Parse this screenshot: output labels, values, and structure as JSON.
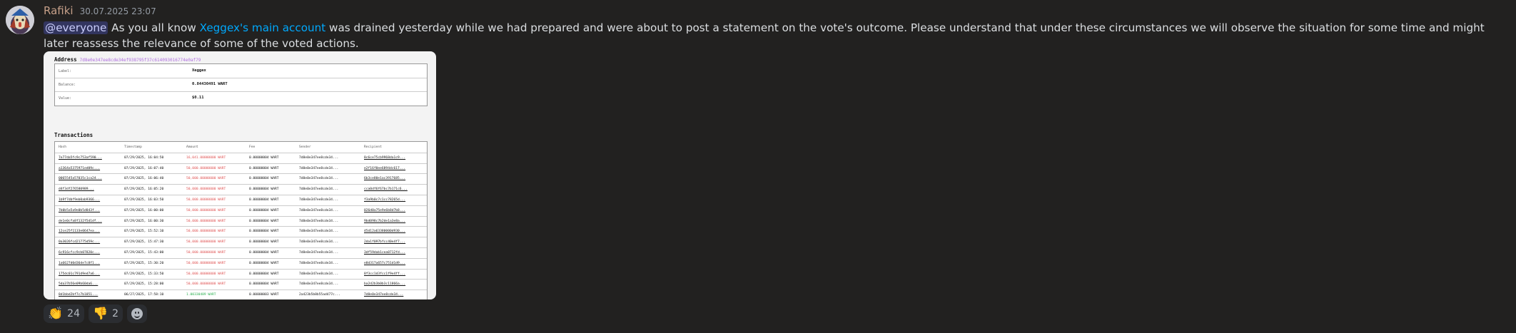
{
  "message": {
    "username": "Rafiki",
    "timestamp": "30.07.2025 23:07",
    "mention": "@everyone",
    "text_before_link": " As you all know ",
    "link_text": "Xeggex's main account",
    "text_after_link": " was drained yesterday while we had prepared and were about to post a statement on the vote's outcome. Please understand that under these circumstances we will observe the situation for some time and might later reassess the relevance of some of the voted actions."
  },
  "embed": {
    "address_title": "Address",
    "address_hash": "7d8e0e347ee8cde34ef938795f37c614093016774e0af79",
    "address_rows": [
      {
        "key": "Label:",
        "value": "Xeggex"
      },
      {
        "key": "Balance:",
        "value": "0.84430491 WART"
      },
      {
        "key": "Value:",
        "value": "$0.11"
      }
    ],
    "transactions_title": "Transactions",
    "columns": [
      "Hash",
      "Timestamp",
      "Amount",
      "Fee",
      "Sender",
      "Recipient"
    ],
    "rows": [
      [
        "7e77da5fc9c753af590...",
        "07/29/2025, 16:04:50",
        "16,041.00000000 WART",
        "0.00000004 WART",
        "7d8e0e347ee8cde34...",
        "8c6ce75cb9968da1c9..."
      ],
      [
        "a1364a5375971ed09c...",
        "07/29/2025, 16:07:40",
        "50,000.00000000 WART",
        "0.00000004 WART",
        "7d8e0e347ee8cde34...",
        "e2f16f0ee6894dc617..."
      ],
      [
        "0065545a57035c1ca24...",
        "07/29/2025, 16:06:40",
        "50,000.00000000 WART",
        "0.00000004 WART",
        "7d8e0e347ee8cde34...",
        "6b3ce80e1ac3917685..."
      ],
      [
        "d4f3df276580989...",
        "07/29/2025, 16:05:20",
        "50,000.00000000 WART",
        "0.00000004 WART",
        "7d8e0e347ee8cde34...",
        "cca0df6f67bc7b171c6..."
      ],
      [
        "1b9f7dbf9eb0ab9366...",
        "07/29/2025, 16:03:50",
        "50,000.00000000 WART",
        "0.00000004 WART",
        "7d8e0e347ee8cde34...",
        "f3a9b0c7c1cc78265d..."
      ],
      [
        "7b0b5a5a9e0b5d843f...",
        "07/29/2025, 16:00:00",
        "50,000.00000000 WART",
        "0.00000004 WART",
        "7d8e0e347ee8cde34...",
        "026d0a75e9e6b8d7b8..."
      ],
      [
        "de1e0cfa8f132f5d1df...",
        "07/29/2025, 16:00:30",
        "50,000.00000000 WART",
        "0.00000004 WART",
        "7d8e0e347ee8cde34...",
        "9bd098c7b2de1a3e8a..."
      ],
      [
        "12ce25f1133e0647ea...",
        "07/29/2025, 15:52:10",
        "50,000.00000000 WART",
        "0.00000004 WART",
        "7d8e0e347ee8cde34...",
        "45d12a63380000d930..."
      ],
      [
        "0a3026fcd21775d59c...",
        "07/29/2025, 15:47:30",
        "50,000.00000000 WART",
        "0.00000004 WART",
        "7d8e0e347ee8cde34...",
        "2da1f097bfcc40e4f7..."
      ],
      [
        "6c916cfcc9cb07820c...",
        "07/29/2025, 15:43:00",
        "50,000.00000000 WART",
        "0.00000004 WART",
        "7d8e0e347ee8cde34...",
        "3df59dab1cea0712fd..."
      ],
      [
        "1a6627d0d36de7c8f1...",
        "07/29/2025, 15:30:20",
        "50,000.00000000 WART",
        "0.00000004 WART",
        "7d8e0e347ee8cde34...",
        "e8d317a657c751d1d9..."
      ],
      [
        "175dc01c791d9ed7a6...",
        "07/29/2025, 15:33:50",
        "50,000.00000000 WART",
        "0.00000004 WART",
        "7d8e0e347ee8cde34...",
        "8f3cc1d3fcc1f9e4ff..."
      ],
      [
        "5da37b56e09b60da6...",
        "07/29/2025, 15:28:00",
        "50,000.00000000 WART",
        "0.00000004 WART",
        "7d8e0e347ee8cde34...",
        "ba2d2b3b0b3c11866a..."
      ],
      [
        "8d1bbd2bf7c7b1851...",
        "06/27/2025, 17:58:10",
        "1.00330489 WART",
        "0.00000003 WART",
        "2a423b5b8b55ad477c...",
        "7d8e0e347ee8cde34..."
      ]
    ]
  },
  "reactions": [
    {
      "emoji": "👏",
      "count": "24"
    },
    {
      "emoji": "👎",
      "count": "2"
    }
  ],
  "colors": {
    "username": "#c6a089",
    "link": "#00a8fc",
    "amount_out": "#e05555",
    "amount_in": "#29b04e"
  }
}
